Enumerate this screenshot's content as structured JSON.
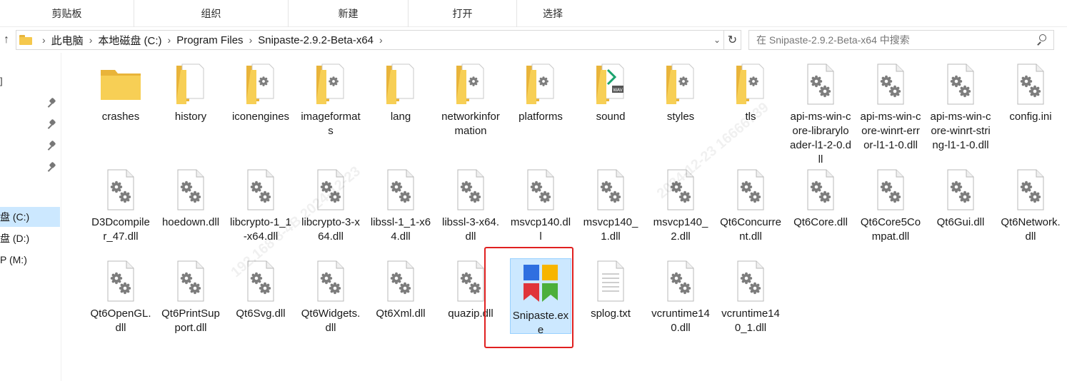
{
  "ribbon": {
    "groups": [
      "剪贴板",
      "组织",
      "新建",
      "打开",
      "选择"
    ]
  },
  "address": {
    "path": [
      "此电脑",
      "本地磁盘 (C:)",
      "Program Files",
      "Snipaste-2.9.2-Beta-x64"
    ],
    "search_placeholder": "在 Snipaste-2.9.2-Beta-x64 中搜索"
  },
  "nav": {
    "drives": [
      "盘 (C:)",
      "盘 (D:)",
      "P (M:)"
    ],
    "selected_drive": "盘 (C:)"
  },
  "items": [
    {
      "name": "crashes",
      "kind": "folder"
    },
    {
      "name": "history",
      "kind": "folder-doc"
    },
    {
      "name": "iconengines",
      "kind": "folder-gear"
    },
    {
      "name": "imageformats",
      "kind": "folder-gear"
    },
    {
      "name": "lang",
      "kind": "folder-doc"
    },
    {
      "name": "networkinformation",
      "kind": "folder-gear"
    },
    {
      "name": "platforms",
      "kind": "folder-gear"
    },
    {
      "name": "sound",
      "kind": "folder-wav"
    },
    {
      "name": "styles",
      "kind": "folder-gear"
    },
    {
      "name": "tls",
      "kind": "folder-gear"
    },
    {
      "name": "api-ms-win-core-libraryloader-l1-2-0.dll",
      "kind": "dll"
    },
    {
      "name": "api-ms-win-core-winrt-error-l1-1-0.dll",
      "kind": "dll"
    },
    {
      "name": "api-ms-win-core-winrt-string-l1-1-0.dll",
      "kind": "dll"
    },
    {
      "name": "config.ini",
      "kind": "dll"
    },
    {
      "name": "D3Dcompiler_47.dll",
      "kind": "dll"
    },
    {
      "name": "hoedown.dll",
      "kind": "dll"
    },
    {
      "name": "libcrypto-1_1-x64.dll",
      "kind": "dll"
    },
    {
      "name": "libcrypto-3-x64.dll",
      "kind": "dll"
    },
    {
      "name": "libssl-1_1-x64.dll",
      "kind": "dll"
    },
    {
      "name": "libssl-3-x64.dll",
      "kind": "dll"
    },
    {
      "name": "msvcp140.dll",
      "kind": "dll"
    },
    {
      "name": "msvcp140_1.dll",
      "kind": "dll"
    },
    {
      "name": "msvcp140_2.dll",
      "kind": "dll"
    },
    {
      "name": "Qt6Concurrent.dll",
      "kind": "dll"
    },
    {
      "name": "Qt6Core.dll",
      "kind": "dll"
    },
    {
      "name": "Qt6Core5Compat.dll",
      "kind": "dll"
    },
    {
      "name": "Qt6Gui.dll",
      "kind": "dll"
    },
    {
      "name": "Qt6Network.dll",
      "kind": "dll"
    },
    {
      "name": "Qt6OpenGL.dll",
      "kind": "dll"
    },
    {
      "name": "Qt6PrintSupport.dll",
      "kind": "dll"
    },
    {
      "name": "Qt6Svg.dll",
      "kind": "dll"
    },
    {
      "name": "Qt6Widgets.dll",
      "kind": "dll"
    },
    {
      "name": "Qt6Xml.dll",
      "kind": "dll"
    },
    {
      "name": "quazip.dll",
      "kind": "dll"
    },
    {
      "name": "Snipaste.exe",
      "kind": "exe"
    },
    {
      "name": "splog.txt",
      "kind": "txt"
    },
    {
      "name": "vcruntime140.dll",
      "kind": "dll"
    },
    {
      "name": "vcruntime140_1.dll",
      "kind": "dll"
    }
  ],
  "selected_item": "Snipaste.exe",
  "colors": {
    "selection": "#cce8ff",
    "highlight_border": "#e02020",
    "folder": "#f5c84c"
  }
}
